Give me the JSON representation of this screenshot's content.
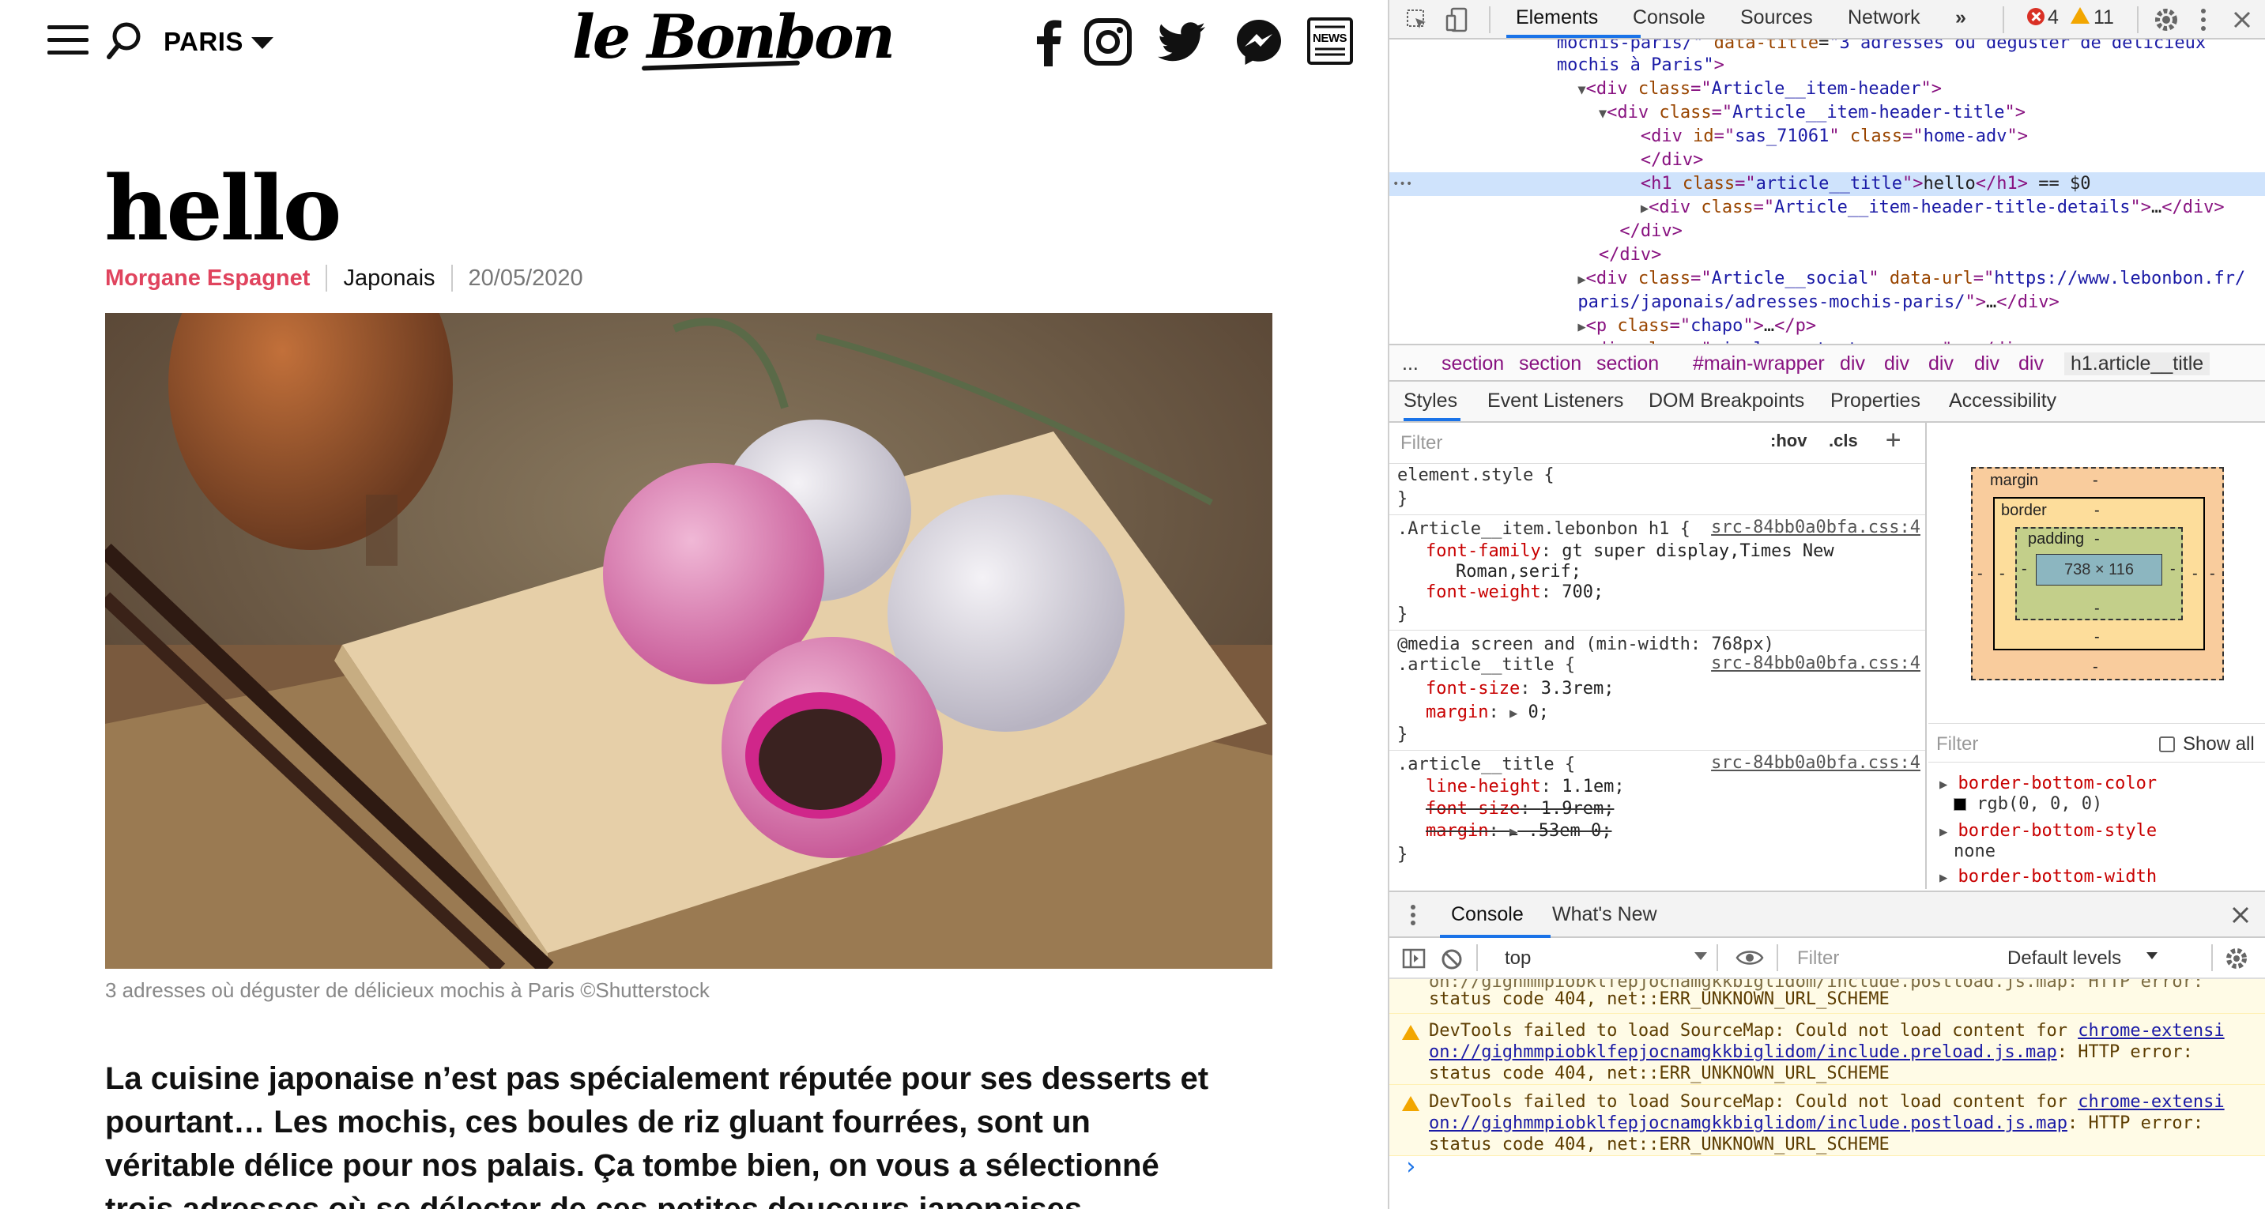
{
  "site": {
    "city": "PARIS",
    "logo": "le Bonbon",
    "news_label": "NEWS",
    "article": {
      "title": "hello",
      "author": "Morgane Espagnet",
      "category": "Japonais",
      "date": "20/05/2020",
      "image_caption": "3 adresses où déguster de délicieux mochis à Paris ©Shutterstock",
      "chapo_lines": [
        "La cuisine japonaise n’est pas spécialement réputée pour ses desserts et",
        "pourtant… Les mochis, ces boules de riz gluant fourrées, sont un",
        "véritable délice pour nos palais. Ça tombe bien, on vous a sélectionné",
        "trois adresses où se délecter de ces petites douceurs japonaises."
      ]
    },
    "icons": [
      "menu-icon",
      "search-icon",
      "chevron-down-icon",
      "facebook-icon",
      "instagram-icon",
      "twitter-icon",
      "messenger-icon",
      "news-icon"
    ]
  },
  "devtools": {
    "tabs": [
      "Elements",
      "Console",
      "Sources",
      "Network",
      "»"
    ],
    "errors": "4",
    "warnings": "11",
    "elements_lines": [
      {
        "indent": 8,
        "tri": "",
        "parts": [
          [
            "val",
            "mochis-paris/\" "
          ],
          [
            "attr",
            "data-title"
          ],
          [
            "txt",
            "="
          ],
          [
            "val",
            "\"3 adresses où déguster de délicieux"
          ]
        ]
      },
      {
        "indent": 8,
        "tri": "",
        "parts": [
          [
            "val",
            "mochis à Paris\""
          ],
          [
            "tag",
            ">"
          ]
        ]
      },
      {
        "indent": 9,
        "tri": "▼",
        "parts": [
          [
            "tag",
            "<div "
          ],
          [
            "attr",
            "class"
          ],
          [
            "tag",
            "=\""
          ],
          [
            "val",
            "Article__item-header"
          ],
          [
            "tag",
            "\">"
          ]
        ]
      },
      {
        "indent": 10,
        "tri": "▼",
        "parts": [
          [
            "tag",
            "<div "
          ],
          [
            "attr",
            "class"
          ],
          [
            "tag",
            "=\""
          ],
          [
            "val",
            "Article__item-header-title"
          ],
          [
            "tag",
            "\">"
          ]
        ]
      },
      {
        "indent": 12,
        "tri": "",
        "parts": [
          [
            "tag",
            "<div "
          ],
          [
            "attr",
            "id"
          ],
          [
            "tag",
            "=\""
          ],
          [
            "val",
            "sas_71061"
          ],
          [
            "tag",
            "\" "
          ],
          [
            "attr",
            "class"
          ],
          [
            "tag",
            "=\""
          ],
          [
            "val",
            "home-adv"
          ],
          [
            "tag",
            "\">"
          ]
        ]
      },
      {
        "indent": 12,
        "tri": "",
        "parts": [
          [
            "tag",
            "</div>"
          ]
        ]
      },
      {
        "indent": 12,
        "tri": "",
        "parts": [
          [
            "tag",
            "<h1 "
          ],
          [
            "attr",
            "class"
          ],
          [
            "tag",
            "=\""
          ],
          [
            "val",
            "article__title"
          ],
          [
            "tag",
            "\">"
          ],
          [
            "txt",
            "hello"
          ],
          [
            "tag",
            "</h1>"
          ],
          [
            "txt",
            " == $0"
          ]
        ]
      },
      {
        "indent": 12,
        "tri": "▶",
        "parts": [
          [
            "tag",
            "<div "
          ],
          [
            "attr",
            "class"
          ],
          [
            "tag",
            "=\""
          ],
          [
            "val",
            "Article__item-header-title-details"
          ],
          [
            "tag",
            "\">"
          ],
          [
            "txt",
            "…"
          ],
          [
            "tag",
            "</div>"
          ]
        ]
      },
      {
        "indent": 11,
        "tri": "",
        "parts": [
          [
            "tag",
            "</div>"
          ]
        ]
      },
      {
        "indent": 10,
        "tri": "",
        "parts": [
          [
            "tag",
            "</div>"
          ]
        ]
      },
      {
        "indent": 9,
        "tri": "▶",
        "parts": [
          [
            "tag",
            "<div "
          ],
          [
            "attr",
            "class"
          ],
          [
            "tag",
            "=\""
          ],
          [
            "val",
            "Article__social"
          ],
          [
            "tag",
            "\" "
          ],
          [
            "attr",
            "data-url"
          ],
          [
            "tag",
            "=\""
          ],
          [
            "val",
            "https://www.lebonbon.fr/"
          ]
        ]
      },
      {
        "indent": 9,
        "tri": "",
        "parts": [
          [
            "val",
            "paris/japonais/adresses-mochis-paris/"
          ],
          [
            "tag",
            "\">"
          ],
          [
            "txt",
            "…"
          ],
          [
            "tag",
            "</div>"
          ]
        ]
      },
      {
        "indent": 9,
        "tri": "▶",
        "parts": [
          [
            "tag",
            "<p "
          ],
          [
            "attr",
            "class"
          ],
          [
            "tag",
            "=\""
          ],
          [
            "val",
            "chapo"
          ],
          [
            "tag",
            "\">"
          ],
          [
            "txt",
            "…"
          ],
          [
            "tag",
            "</p>"
          ]
        ]
      },
      {
        "indent": 9,
        "tri": "▶",
        "parts": [
          [
            "tag",
            "<div "
          ],
          [
            "attr",
            "class"
          ],
          [
            "tag",
            "=\""
          ],
          [
            "val",
            "simple-content-wrapper"
          ],
          [
            "tag",
            "\">"
          ],
          [
            "txt",
            "…"
          ],
          [
            "tag",
            "</div>"
          ]
        ]
      }
    ],
    "breadcrumbs": [
      "...",
      "section",
      "section",
      "section",
      "#main-wrapper",
      "div",
      "div",
      "div",
      "div",
      "div",
      "h1.article__title"
    ],
    "subtabs": [
      "Styles",
      "Event Listeners",
      "DOM Breakpoints",
      "Properties",
      "Accessibility"
    ],
    "styles_filter_placeholder": "Filter",
    "hov": ":hov",
    "cls": ".cls",
    "plus": "+",
    "rules": {
      "element_style": "element.style {",
      "close": "}",
      "rule1_selector": ".Article__item.lebonbon h1 {",
      "rule1_src": "src-84bb0a0bfa.css:4",
      "rule1_p1_name": "font-family",
      "rule1_p1_val": "gt super display,Times New",
      "rule1_p1_val2": "Roman,serif;",
      "rule1_p2_name": "font-weight",
      "rule1_p2_val": "700;",
      "rule2_media": "@media screen and (min-width: 768px)",
      "rule2_selector": ".article__title {",
      "rule2_src": "src-84bb0a0bfa.css:4",
      "rule2_p1_name": "font-size",
      "rule2_p1_val": "3.3rem;",
      "rule2_p2_name": "margin",
      "rule2_p2_val": "0;",
      "rule3_selector": ".article__title {",
      "rule3_src": "src-84bb0a0bfa.css:4",
      "rule3_p1_name": "line-height",
      "rule3_p1_val": "1.1em;",
      "rule3_p2_name": "font-size",
      "rule3_p2_val": "1.9rem;",
      "rule3_p3_name": "margin",
      "rule3_p3_val": ".53em 0;"
    },
    "boxmodel": {
      "margin": "margin",
      "border": "border",
      "padding": "padding",
      "dash": "-",
      "content": "738 × 116"
    },
    "computed": {
      "filter_placeholder": "Filter",
      "show_all": "Show all",
      "props": [
        {
          "name": "border-bottom-color",
          "value": "rgb(0, 0, 0)"
        },
        {
          "name": "border-bottom-style",
          "value": "none"
        },
        {
          "name": "border-bottom-width",
          "value": ""
        }
      ]
    },
    "drawer_tabs": [
      "Console",
      "What's New"
    ],
    "console_context": "top",
    "console_filter_placeholder": "Filter",
    "console_levels": "Default levels",
    "console_messages": [
      {
        "lines": [
          [
            "",
            "status code 404, net::ERR_UNKNOWN_URL_SCHEME"
          ]
        ],
        "partial": true
      },
      {
        "lines": [
          [
            "",
            "DevTools failed to load SourceMap: Could not load content for "
          ],
          [
            "link",
            "chrome-extensi"
          ]
        ],
        "l2": "on://gighmmpiobklfepjocnamgkkbiglidom/include.preload.js.map",
        "l2b": ": HTTP error:",
        "l3": "status code 404, net::ERR_UNKNOWN_URL_SCHEME"
      },
      {
        "lines": [
          [
            "",
            "DevTools failed to load SourceMap: Could not load content for "
          ],
          [
            "link",
            "chrome-extensi"
          ]
        ],
        "l2": "on://gighmmpiobklfepjocnamgkkbiglidom/include.postload.js.map",
        "l2b": ": HTTP error:",
        "l3": "status code 404, net::ERR_UNKNOWN_URL_SCHEME"
      }
    ],
    "prompt": "›"
  }
}
